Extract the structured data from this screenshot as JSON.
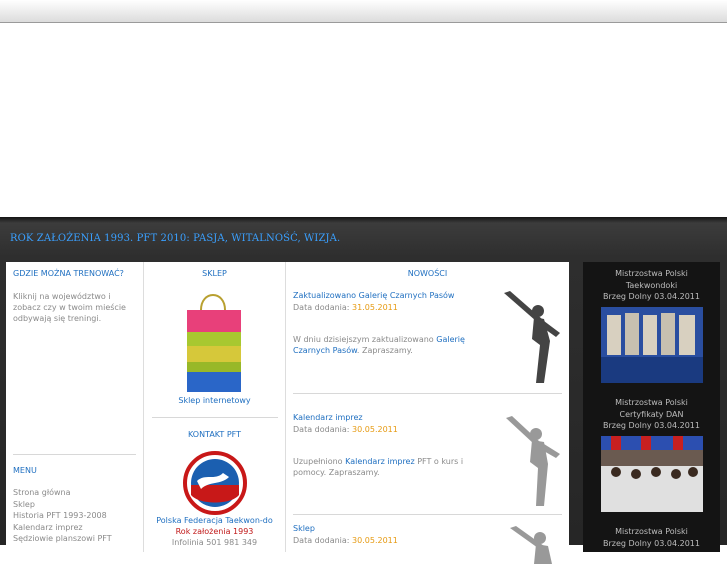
{
  "slogan": "ROK ZAŁOŻENIA 1993. PFT 2010: PASJA, WITALNOŚĆ, WIZJA.",
  "col_train": {
    "heading": "GDZIE MOŻNA TRENOWAĆ?",
    "text": "Kliknij na województwo i zobacz czy w twoim mieście odbywają się treningi."
  },
  "menu": {
    "heading": "MENU",
    "items": [
      "Strona główna",
      "Sklep",
      "Historia PFT 1993-2008",
      "Kalendarz imprez",
      "Sędziowie planszowi PFT"
    ]
  },
  "shop": {
    "heading": "SKLEP",
    "link": "Sklep internetowy"
  },
  "contact": {
    "heading": "KONTAKT PFT",
    "org": "Polska Federacja Taekwon-do",
    "founded": "Rok założenia 1993",
    "hotline": "Infolinia 501 981 349",
    "logo_text": "POLSKA FEDERACJA TAEKWON-DO"
  },
  "news": {
    "heading": "NOWOŚCI",
    "posts": [
      {
        "title": "Zaktualizowano Galerię Czarnych Pasów",
        "date_label": "Data dodania:",
        "date": "31.05.2011",
        "body_pre": "W dniu dzisiejszym zaktualizowano",
        "body_link": "Galerię Czarnych Pasów",
        "body_post": ". Zapraszamy."
      },
      {
        "title": "Kalendarz imprez",
        "date_label": "Data dodania:",
        "date": "30.05.2011",
        "body_pre": "Uzupełniono",
        "body_link": "Kalendarz imprez",
        "body_post": "PFT o kurs i pomocy. Zapraszamy."
      },
      {
        "title": "Sklep",
        "date_label": "Data dodania:",
        "date": "30.05.2011"
      }
    ]
  },
  "sidebar_events": [
    {
      "title": "Mistrzostwa Polski Taekwondoki",
      "place_date": "Brzeg Dolny 03.04.2011"
    },
    {
      "title": "Mistrzostwa Polski Certyfikaty DAN",
      "place_date": "Brzeg Dolny 03.04.2011"
    },
    {
      "title": "Mistrzostwa Polski",
      "place_date": "Brzeg Dolny 03.04.2011"
    }
  ],
  "colors": {
    "accent_blue": "#1f6fc0",
    "date_orange": "#e69a12",
    "slogan_blue": "#3aa0ff",
    "founded_red": "#c01818"
  }
}
